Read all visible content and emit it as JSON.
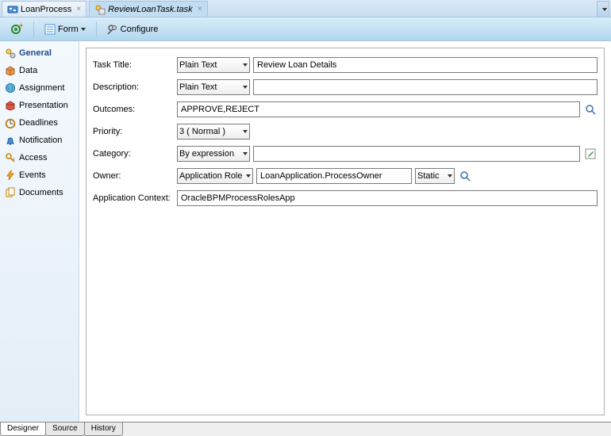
{
  "tabs": {
    "items": [
      {
        "label": "LoanProcess",
        "active": false
      },
      {
        "label": "ReviewLoanTask.task",
        "active": true
      }
    ]
  },
  "toolbar": {
    "form_label": "Form",
    "configure_label": "Configure"
  },
  "sidebar": {
    "items": [
      {
        "label": "General",
        "active": true
      },
      {
        "label": "Data"
      },
      {
        "label": "Assignment"
      },
      {
        "label": "Presentation"
      },
      {
        "label": "Deadlines"
      },
      {
        "label": "Notification"
      },
      {
        "label": "Access"
      },
      {
        "label": "Events"
      },
      {
        "label": "Documents"
      }
    ]
  },
  "form": {
    "task_title": {
      "label": "Task Title:",
      "type": "Plain Text",
      "value": "Review Loan Details"
    },
    "description": {
      "label": "Description:",
      "type": "Plain Text",
      "value": ""
    },
    "outcomes": {
      "label": "Outcomes:",
      "value": "APPROVE,REJECT"
    },
    "priority": {
      "label": "Priority:",
      "value": "3 ( Normal )"
    },
    "category": {
      "label": "Category:",
      "type": "By expression",
      "value": ""
    },
    "owner": {
      "label": "Owner:",
      "type": "Application Role",
      "value": "LoanApplication.ProcessOwner",
      "mode": "Static"
    },
    "app_context": {
      "label": "Application Context:",
      "value": "OracleBPMProcessRolesApp"
    }
  },
  "bottom_tabs": {
    "items": [
      {
        "label": "Designer",
        "active": true
      },
      {
        "label": "Source"
      },
      {
        "label": "History"
      }
    ]
  }
}
